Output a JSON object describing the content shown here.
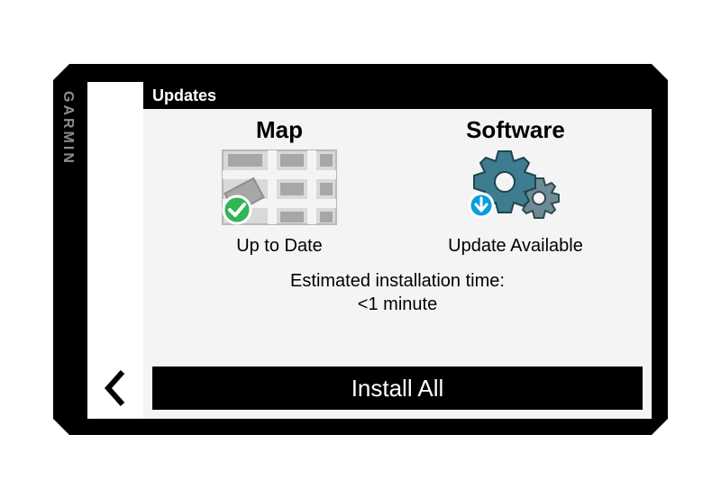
{
  "brand": "GARMIN",
  "header": {
    "title": "Updates"
  },
  "tiles": {
    "map": {
      "title": "Map",
      "status": "Up to Date"
    },
    "software": {
      "title": "Software",
      "status": "Update Available"
    }
  },
  "estimate": {
    "label": "Estimated installation time:",
    "value": "<1 minute"
  },
  "actions": {
    "install": "Install All"
  },
  "colors": {
    "accent_teal": "#3d7d8f",
    "ok_green": "#2fb456",
    "dl_blue": "#0a9de0"
  }
}
